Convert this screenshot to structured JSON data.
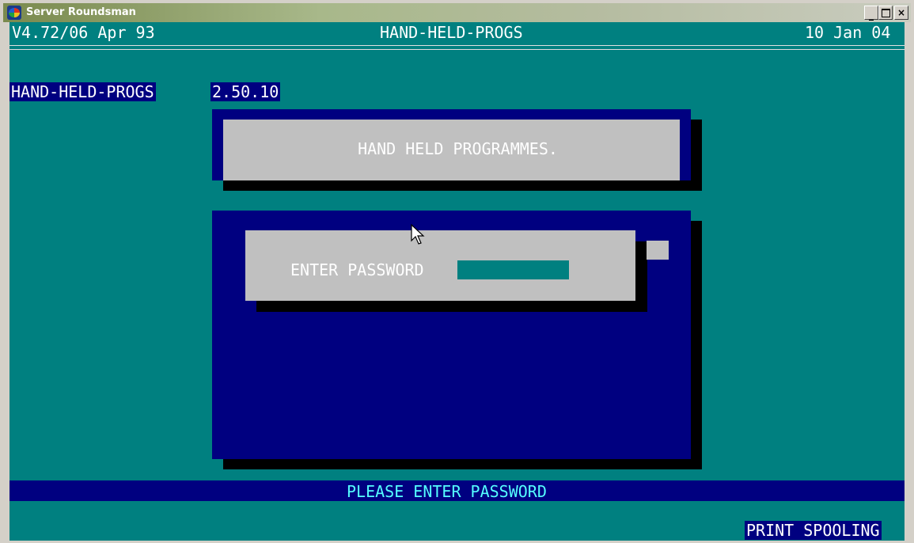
{
  "window": {
    "title": "Server Roundsman"
  },
  "header": {
    "version": "V4.72/06 Apr 93",
    "screen_name": "HAND-HELD-PROGS",
    "date": "10 Jan 04"
  },
  "program": {
    "name": "HAND-HELD-PROGS",
    "version": "2.50.10"
  },
  "main": {
    "title": "HAND HELD PROGRAMMES."
  },
  "login": {
    "password_label": "ENTER PASSWORD",
    "password_value": ""
  },
  "status": {
    "message": "PLEASE ENTER PASSWORD",
    "print_status": "PRINT SPOOLING"
  },
  "colors": {
    "background": "#008080",
    "dialog": "#000080",
    "panel": "#c0c0c0",
    "status_text": "#55ffff"
  },
  "icons": [
    "app-icon",
    "minimize-icon",
    "maximize-icon",
    "close-icon",
    "mouse-pointer-icon"
  ]
}
